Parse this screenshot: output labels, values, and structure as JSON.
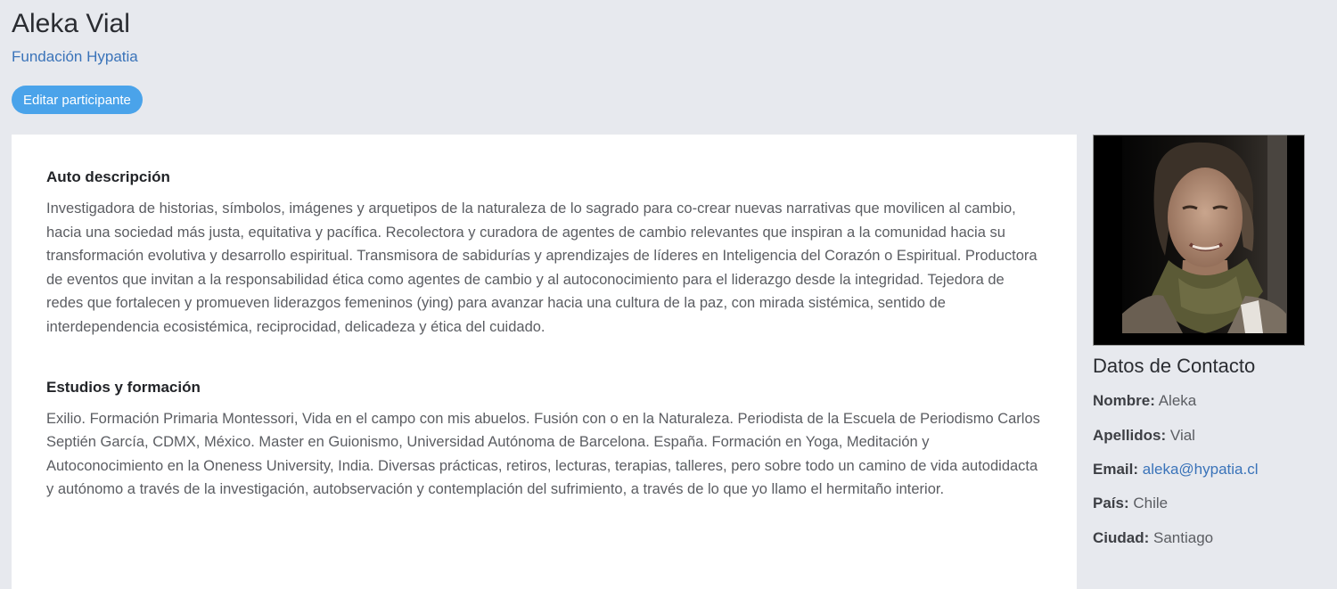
{
  "header": {
    "name": "Aleka Vial",
    "organization": "Fundación Hypatia",
    "edit_button": "Editar participante"
  },
  "sections": {
    "self_description": {
      "title": "Auto descripción",
      "text": "Investigadora de historias, símbolos, imágenes y arquetipos de la naturaleza de lo sagrado para co-crear nuevas narrativas que movilicen al cambio, hacia una sociedad más justa, equitativa y pacífica. Recolectora y curadora de agentes de cambio relevantes que inspiran a la comunidad hacia su transformación evolutiva y desarrollo espiritual. Transmisora de sabidurías y aprendizajes de líderes en Inteligencia del Corazón o Espiritual. Productora de eventos que invitan a la responsabilidad ética como agentes de cambio y al autoconocimiento para el liderazgo desde la integridad. Tejedora de redes que fortalecen y promueven liderazgos femeninos (ying) para avanzar hacia una cultura de la paz, con mirada sistémica, sentido de interdependencia ecosistémica, reciprocidad, delicadeza y ética del cuidado."
    },
    "studies": {
      "title": "Estudios y formación",
      "text": "Exilio. Formación Primaria Montessori, Vida en el campo con mis abuelos. Fusión con o en la Naturaleza. Periodista de la Escuela de Periodismo Carlos Septién García, CDMX, México. Master en Guionismo, Universidad Autónoma de Barcelona. España. Formación en Yoga, Meditación y Autoconocimiento en la Oneness University, India. Diversas prácticas, retiros, lecturas, terapias, talleres, pero sobre todo un camino de vida autodidacta y autónomo a través de la investigación, autobservación y contemplación del sufrimiento, a través de lo que yo llamo el hermitaño interior."
    }
  },
  "contact": {
    "title": "Datos de Contacto",
    "first_name_label": "Nombre:",
    "first_name": "Aleka",
    "last_name_label": "Apellidos:",
    "last_name": "Vial",
    "email_label": "Email:",
    "email": "aleka@hypatia.cl",
    "country_label": "País:",
    "country": "Chile",
    "city_label": "Ciudad:",
    "city": "Santiago"
  },
  "colors": {
    "background": "#e7e9ee",
    "button": "#4aa3ea",
    "link": "#3a73b9"
  }
}
